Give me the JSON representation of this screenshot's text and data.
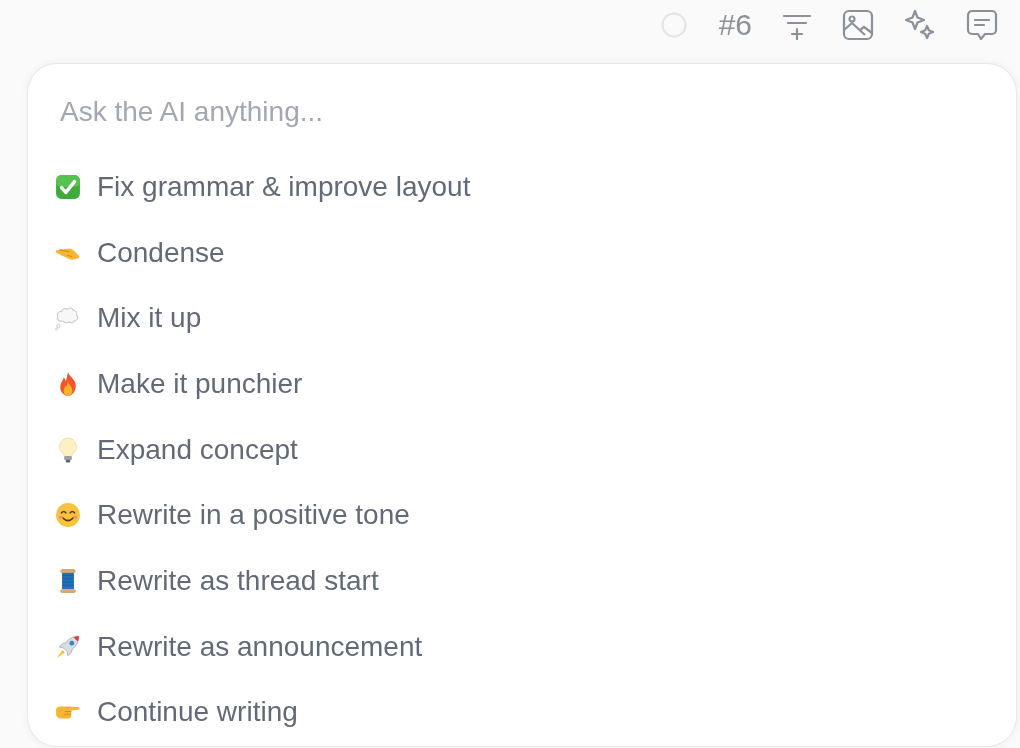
{
  "toolbar": {
    "item_number": "#6"
  },
  "prompt": {
    "placeholder": "Ask the AI anything..."
  },
  "suggestions": [
    {
      "label": "Fix grammar & improve layout"
    },
    {
      "label": "Condense"
    },
    {
      "label": "Mix it up"
    },
    {
      "label": "Make it punchier"
    },
    {
      "label": "Expand concept"
    },
    {
      "label": "Rewrite in a positive tone"
    },
    {
      "label": "Rewrite as thread start"
    },
    {
      "label": "Rewrite as announcement"
    },
    {
      "label": "Continue writing"
    }
  ]
}
